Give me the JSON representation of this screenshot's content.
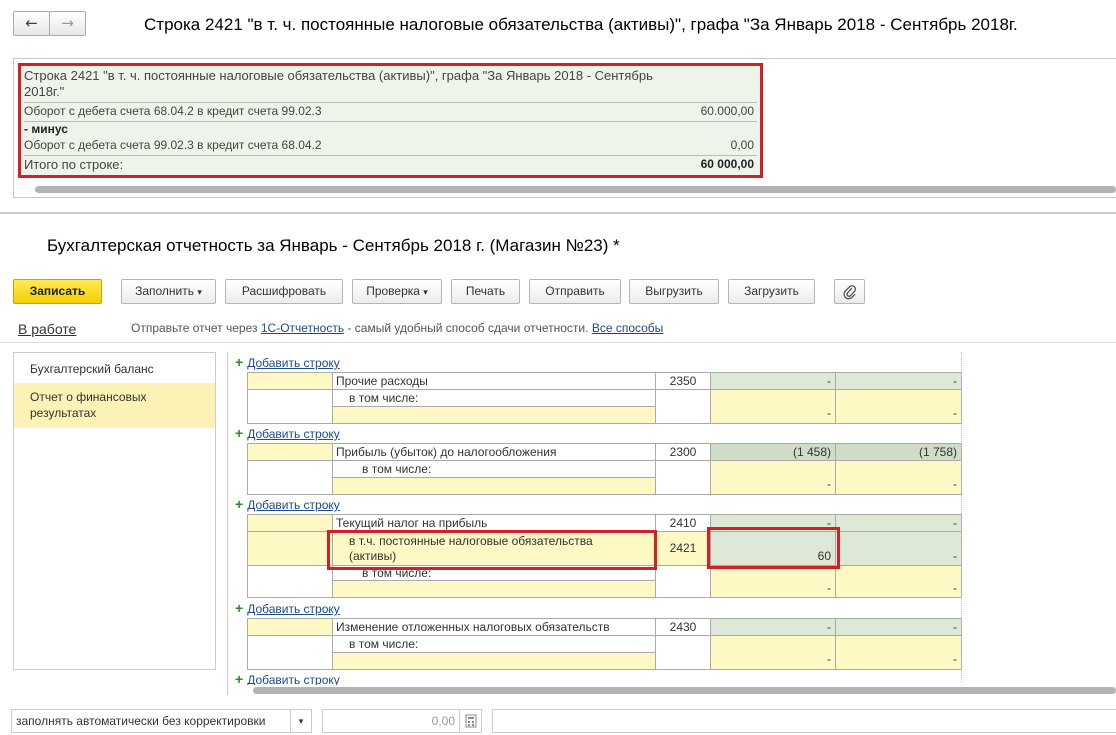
{
  "nav": {
    "back_label": "←",
    "forward_label": "→"
  },
  "window_title": "Строка 2421 \"в т. ч. постоянные налоговые обязательства (активы)\", графа \"За Январь 2018 - Сентябрь 2018г.",
  "decode": {
    "header_line1": "Строка 2421 \"в т. ч. постоянные налоговые обязательства (активы)\", графа \"За Январь 2018 - Сентябрь",
    "header_line2": "2018г.\"",
    "row1_label": "Оборот с дебета счета 68.04.2 в кредит счета 99.02.3",
    "row1_value": "60.000,00",
    "minus_label": "- минус",
    "row2_label": "Оборот с дебета счета 99.02.3 в кредит счета 68.04.2",
    "row2_value": "0,00",
    "total_label": "Итого по строке:",
    "total_value": "60 000,00"
  },
  "report_title": "Бухгалтерская отчетность за Январь - Сентябрь 2018 г. (Магазин №23) *",
  "toolbar": {
    "save": "Записать",
    "fill": "Заполнить",
    "decode": "Расшифровать",
    "check": "Проверка",
    "print": "Печать",
    "send": "Отправить",
    "export": "Выгрузить",
    "import": "Загрузить",
    "dropdown_arrow": "▾",
    "attach_icon": "paperclip-icon"
  },
  "status": {
    "label": "В работе",
    "hint_prefix": "Отправьте отчет через",
    "hint_link1": "1С-Отчетность",
    "hint_middle": "- самый удобный способ сдачи отчетности.",
    "hint_link2": "Все способы"
  },
  "sections": [
    "Бухгалтерский баланс",
    "Отчет о финансовых результатах"
  ],
  "add_row_label": "Добавить строку",
  "form": {
    "r2350": {
      "label": "Прочие расходы",
      "code": "2350",
      "v1": "-",
      "v2": "-"
    },
    "r2350_sub": {
      "label": "в том числе:",
      "v1": "-",
      "v2": "-"
    },
    "r2300": {
      "label": "Прибыль (убыток) до налогообложения",
      "code": "2300",
      "v1": "(1 458)",
      "v2": "(1 758)"
    },
    "r2300_sub": {
      "label": "в том числе:",
      "v1": "-",
      "v2": "-"
    },
    "r2410": {
      "label": "Текущий налог на прибыль",
      "code": "2410",
      "v1": "-",
      "v2": "-"
    },
    "r2421": {
      "label_line1": "в т.ч. постоянные налоговые обязательства",
      "label_line2": "(активы)",
      "code": "2421",
      "v1": "60",
      "v2": "-"
    },
    "r2421_sub": {
      "label": "в том числе:",
      "v1": "-",
      "v2": "-"
    },
    "r2430": {
      "label": "Изменение отложенных налоговых обязательств",
      "code": "2430",
      "v1": "-",
      "v2": "-"
    },
    "r2430_sub": {
      "label": "в том числе:",
      "v1": "-",
      "v2": "-"
    }
  },
  "bottom": {
    "mode": "заполнять автоматически без корректировки",
    "mode_arrow": "▾",
    "amount": "0,00",
    "calc_icon": "calculator-icon"
  }
}
